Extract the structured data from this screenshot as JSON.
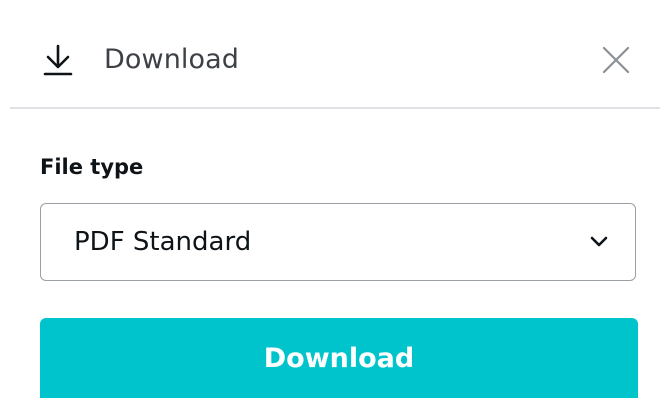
{
  "header": {
    "icon": "download-icon",
    "title": "Download",
    "close_icon": "close-icon"
  },
  "file_type": {
    "label": "File type",
    "selected": "PDF Standard",
    "dropdown_icon": "chevron-down-icon"
  },
  "actions": {
    "download_label": "Download"
  },
  "colors": {
    "accent": "#00c4cc",
    "divider": "#dfe1e4",
    "border": "#9a9fa5"
  }
}
